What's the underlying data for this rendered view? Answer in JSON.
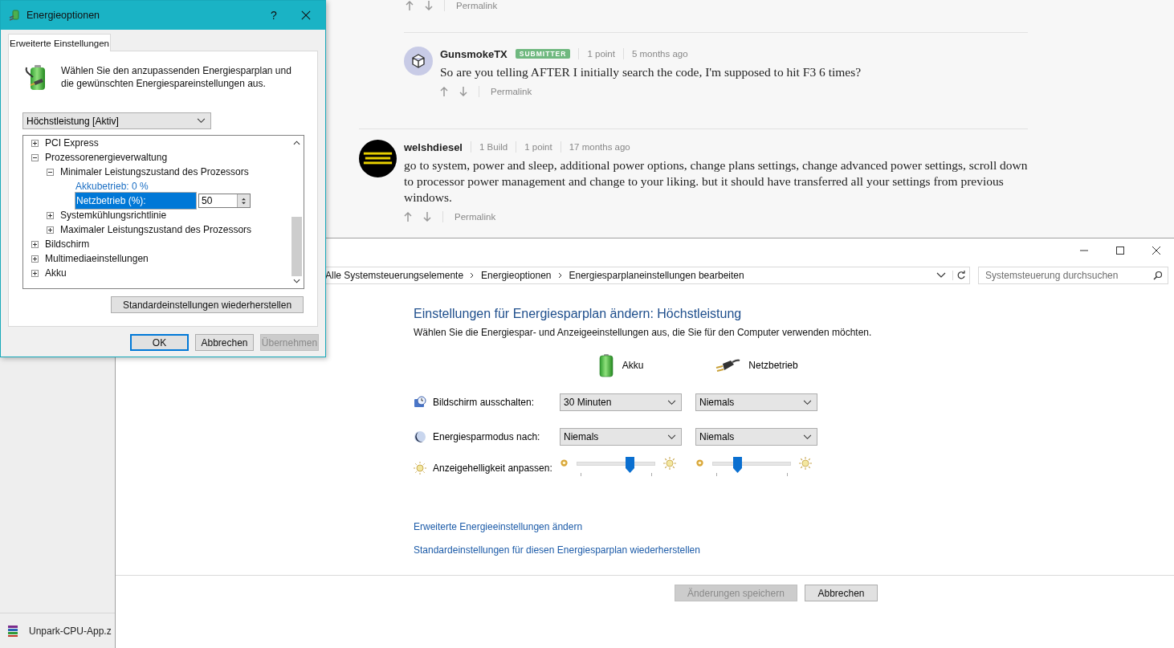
{
  "web_page": {
    "top_actions": {
      "permalink": "Permalink"
    },
    "comments": [
      {
        "avatar": {
          "kind": "icon"
        },
        "name": "GunsmokeTX",
        "badge": "SUBMITTER",
        "meta": [
          "1 point",
          "5 months ago"
        ],
        "text": "So are you telling AFTER I initially search the code, I'm supposed to hit F3 6 times?",
        "permalink": "Permalink"
      },
      {
        "name": "welshdiesel",
        "meta": [
          "1 Build",
          "1 point",
          "17 months ago"
        ],
        "text": "go to system, power and sleep, additional power options, change plans settings, change advanced power settings, scroll down to processor power management and change to your liking. but it should have transferred all your settings from previous windows.",
        "permalink": "Permalink"
      }
    ]
  },
  "download": {
    "filename": "Unpark-CPU-App.z"
  },
  "control_panel": {
    "breadcrumb": [
      "Alle Systemsteuerungselemente",
      "Energieoptionen",
      "Energiesparplaneinstellungen bearbeiten"
    ],
    "search": {
      "placeholder": "Systemsteuerung durchsuchen"
    },
    "heading": "Einstellungen für Energiesparplan ändern: Höchstleistung",
    "subtitle": "Wählen Sie die Energiespar- und Anzeigeeinstellungen aus, die Sie für den Computer verwenden möchten.",
    "columns": [
      {
        "label": "Akku",
        "kind": "battery"
      },
      {
        "label": "Netzbetrieb",
        "kind": "plug"
      }
    ],
    "settings": [
      {
        "kind": "select",
        "label": "Bildschirm ausschalten:",
        "values": [
          "30 Minuten",
          "Niemals"
        ]
      },
      {
        "kind": "select",
        "label": "Energiesparmodus nach:",
        "values": [
          "Niemals",
          "Niemals"
        ]
      },
      {
        "kind": "slider",
        "label": "Anzeigehelligkeit anpassen:",
        "sliders": [
          {
            "level": 0.67
          },
          {
            "level": 0.32
          }
        ]
      }
    ],
    "links": [
      "Erweiterte Energieeinstellungen ändern",
      "Standardeinstellungen für diesen Energiesparplan wiederherstellen"
    ],
    "buttons": [
      {
        "label": "Änderungen speichern",
        "disabled": true
      },
      {
        "label": "Abbrechen",
        "disabled": false
      }
    ]
  },
  "dialog": {
    "title": "Energieoptionen",
    "help": "?",
    "tabs": [
      {
        "label": "Erweiterte Einstellungen",
        "selected": true
      }
    ],
    "description": "Wählen Sie den anzupassenden Energiesparplan und die gewünschten Energiespareinstellungen aus.",
    "plan": "Höchstleistung [Aktiv]",
    "tree": [
      {
        "kind": "group",
        "label": "PCI Express",
        "expanded": false,
        "selected": false
      },
      {
        "kind": "group",
        "label": "Prozessorenergieverwaltung",
        "expanded": true,
        "selected": false,
        "children": [
          {
            "kind": "group",
            "label": "Minimaler Leistungszustand des Prozessors",
            "expanded": true,
            "selected": false,
            "children": [
              {
                "kind": "value",
                "label": "Akkubetrieb: 0 %",
                "selected": false
              },
              {
                "kind": "edit",
                "label": "Netzbetrieb (%):",
                "value": "50",
                "selected": true
              }
            ]
          },
          {
            "kind": "group",
            "label": "Systemkühlungsrichtlinie",
            "expanded": false,
            "selected": false
          },
          {
            "kind": "group",
            "label": "Maximaler Leistungszustand des Prozessors",
            "expanded": false,
            "selected": false
          }
        ]
      },
      {
        "kind": "group",
        "label": "Bildschirm",
        "expanded": false,
        "selected": false
      },
      {
        "kind": "group",
        "label": "Multimediaeinstellungen",
        "expanded": false,
        "selected": false
      },
      {
        "kind": "group",
        "label": "Akku",
        "expanded": false,
        "selected": false
      }
    ],
    "restore_button": "Standardeinstellungen wiederherstellen",
    "buttons": [
      {
        "label": "OK",
        "default": true,
        "disabled": false
      },
      {
        "label": "Abbrechen",
        "default": false,
        "disabled": false
      },
      {
        "label": "Übernehmen",
        "default": false,
        "disabled": true
      }
    ]
  }
}
